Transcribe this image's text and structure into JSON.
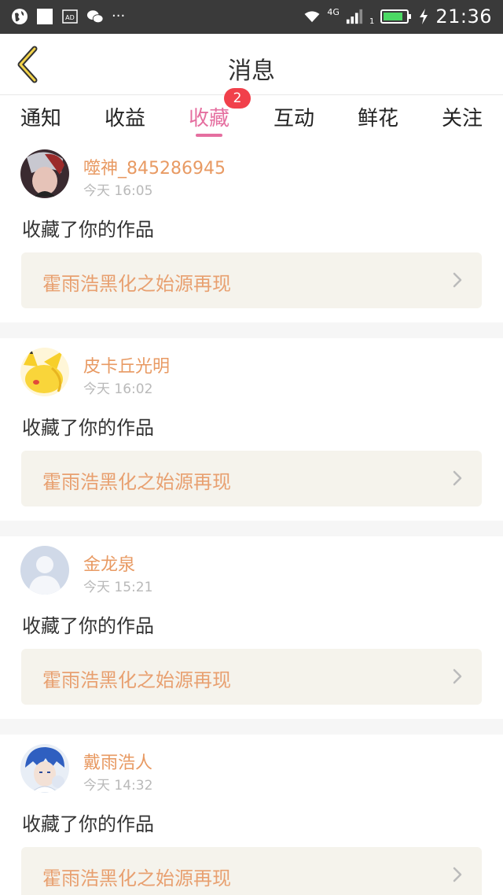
{
  "status_bar": {
    "time": "21:36",
    "network_label": "4G",
    "signal_sub": "1",
    "left_icons": [
      "globe-icon",
      "square-icon",
      "ad-icon",
      "wechat-icon"
    ],
    "more": "···"
  },
  "header": {
    "title": "消息",
    "back_icon": "chevron-left-icon"
  },
  "tabs": [
    {
      "label": "通知"
    },
    {
      "label": "收益"
    },
    {
      "label": "收藏"
    },
    {
      "label": "互动"
    },
    {
      "label": "鲜花"
    },
    {
      "label": "关注"
    }
  ],
  "active_tab": "收藏",
  "badge": "2",
  "colors": {
    "accent_pink": "#e56fa0",
    "username_orange": "#e89a63",
    "badge_red": "#f1404b",
    "work_bg": "#f5f3ec"
  },
  "messages": [
    {
      "username": "噬神_845286945",
      "time": "今天 16:05",
      "action": "收藏了你的作品",
      "work": "霍雨浩黑化之始源再现"
    },
    {
      "username": "皮卡丘光明",
      "time": "今天 16:02",
      "action": "收藏了你的作品",
      "work": "霍雨浩黑化之始源再现"
    },
    {
      "username": "金龙泉",
      "time": "今天 15:21",
      "action": "收藏了你的作品",
      "work": "霍雨浩黑化之始源再现"
    },
    {
      "username": "戴雨浩人",
      "time": "今天 14:32",
      "action": "收藏了你的作品",
      "work": "霍雨浩黑化之始源再现"
    }
  ]
}
